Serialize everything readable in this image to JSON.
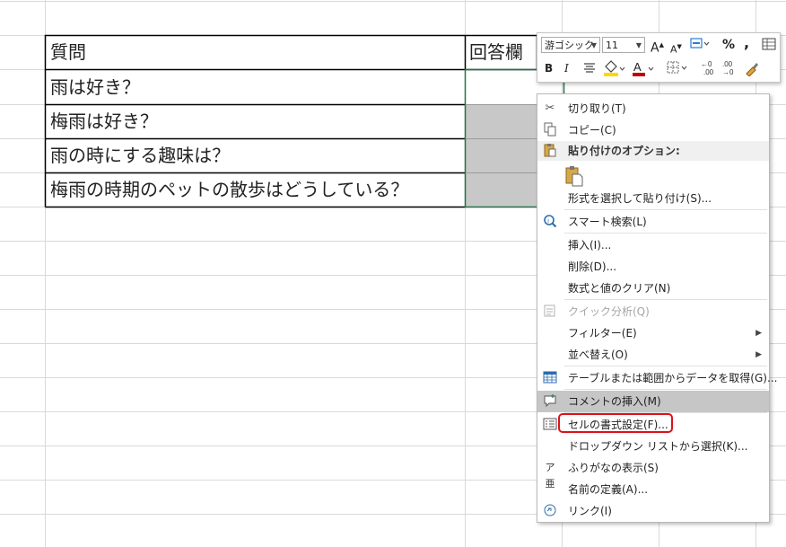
{
  "sheet": {
    "header_question": "質問",
    "header_answer": "回答欄",
    "questions": [
      "雨は好き？",
      "梅雨は好き？",
      "雨の時にする趣味は？",
      "梅雨の時期のペットの散歩はどうしている？"
    ]
  },
  "mini_toolbar": {
    "font_name": "游ゴシック",
    "font_size": "11",
    "grow_font": "A",
    "shrink_font": "A",
    "percent": "%",
    "comma": ",",
    "bold": "B",
    "italic": "I",
    "font_color_letter": "A",
    "inc_decimal": "←0 .00",
    "dec_decimal": ".00 →0",
    "font_color": "#c00000",
    "fill_color": "#ffd700"
  },
  "context_menu": {
    "items": [
      {
        "label": "切り取り(T)",
        "icon": "scissors-icon"
      },
      {
        "label": "コピー(C)",
        "icon": "copy-icon"
      },
      {
        "label": "貼り付けのオプション:",
        "icon": "clipboard-icon"
      },
      {
        "label": "形式を選択して貼り付け(S)...",
        "icon": ""
      },
      {
        "label": "スマート検索(L)",
        "icon": "smart-lookup-icon"
      },
      {
        "label": "挿入(I)...",
        "icon": ""
      },
      {
        "label": "削除(D)...",
        "icon": ""
      },
      {
        "label": "数式と値のクリア(N)",
        "icon": ""
      },
      {
        "label": "クイック分析(Q)",
        "icon": "quick-analysis-icon"
      },
      {
        "label": "フィルター(E)",
        "icon": ""
      },
      {
        "label": "並べ替え(O)",
        "icon": ""
      },
      {
        "label": "テーブルまたは範囲からデータを取得(G)...",
        "icon": "table-icon"
      },
      {
        "label": "コメントの挿入(M)",
        "icon": "comment-icon"
      },
      {
        "label": "セルの書式設定(F)...",
        "icon": "format-cells-icon"
      },
      {
        "label": "ドロップダウン リストから選択(K)...",
        "icon": ""
      },
      {
        "label": "ふりがなの表示(S)",
        "icon": "furigana-icon"
      },
      {
        "label": "名前の定義(A)...",
        "icon": ""
      },
      {
        "label": "リンク(I)",
        "icon": "link-icon"
      }
    ],
    "highlight_color": "#c6c6c6",
    "callout_color": "#e0101a"
  }
}
